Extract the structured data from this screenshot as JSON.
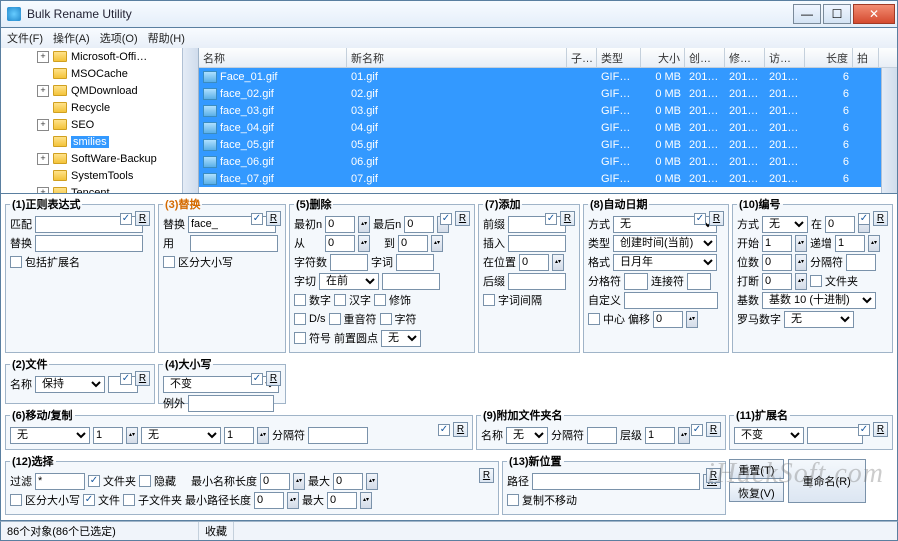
{
  "window": {
    "title": "Bulk Rename Utility"
  },
  "menu": {
    "file": "文件(F)",
    "action": "操作(A)",
    "options": "选项(O)",
    "help": "帮助(H)"
  },
  "tree": [
    {
      "expand": "+",
      "name": "Microsoft-Offi…"
    },
    {
      "expand": "",
      "name": "MSOCache"
    },
    {
      "expand": "+",
      "name": "QMDownload"
    },
    {
      "expand": "",
      "name": "Recycle"
    },
    {
      "expand": "+",
      "name": "SEO"
    },
    {
      "expand": "",
      "name": "smilies",
      "selected": true
    },
    {
      "expand": "+",
      "name": "SoftWare-Backup"
    },
    {
      "expand": "",
      "name": "SystemTools"
    },
    {
      "expand": "+",
      "name": "Tencent"
    }
  ],
  "columns": {
    "name": "名称",
    "newname": "新名称",
    "sub": "子…",
    "type": "类型",
    "size": "大小",
    "created": "创…",
    "modified": "修…",
    "accessed": "访…",
    "length": "长度",
    "taken": "拍"
  },
  "col_w": {
    "name": 148,
    "newname": 220,
    "sub": 30,
    "type": 44,
    "size": 44,
    "created": 40,
    "modified": 40,
    "accessed": 40,
    "length": 48,
    "taken": 26
  },
  "files": [
    {
      "name": "Face_01.gif",
      "new": "01.gif",
      "type": "GIF…",
      "size": "0 MB",
      "c": "201…",
      "m": "201…",
      "a": "201…",
      "len": "6"
    },
    {
      "name": "face_02.gif",
      "new": "02.gif",
      "type": "GIF…",
      "size": "0 MB",
      "c": "201…",
      "m": "201…",
      "a": "201…",
      "len": "6"
    },
    {
      "name": "face_03.gif",
      "new": "03.gif",
      "type": "GIF…",
      "size": "0 MB",
      "c": "201…",
      "m": "201…",
      "a": "201…",
      "len": "6"
    },
    {
      "name": "face_04.gif",
      "new": "04.gif",
      "type": "GIF…",
      "size": "0 MB",
      "c": "201…",
      "m": "201…",
      "a": "201…",
      "len": "6"
    },
    {
      "name": "face_05.gif",
      "new": "05.gif",
      "type": "GIF…",
      "size": "0 MB",
      "c": "201…",
      "m": "201…",
      "a": "201…",
      "len": "6"
    },
    {
      "name": "face_06.gif",
      "new": "06.gif",
      "type": "GIF…",
      "size": "0 MB",
      "c": "201…",
      "m": "201…",
      "a": "201…",
      "len": "6"
    },
    {
      "name": "face_07.gif",
      "new": "07.gif",
      "type": "GIF…",
      "size": "0 MB",
      "c": "201…",
      "m": "201…",
      "a": "201…",
      "len": "6"
    }
  ],
  "p1": {
    "title": "(1)正则表达式",
    "match": "匹配",
    "replace": "替换",
    "incext": "包括扩展名"
  },
  "p3": {
    "title": "(3)替换",
    "replace": "替换",
    "replace_val": "face_",
    "with": "用",
    "case": "区分大小写"
  },
  "p5": {
    "title": "(5)删除",
    "firstn": "最初n",
    "lastn": "最后n",
    "from": "从",
    "to": "到",
    "chars": "字符数",
    "words": "字词",
    "crop": "字切",
    "crop_val": "在前",
    "numbers": "数字",
    "chinese": "汉字",
    "trim": "修饰",
    "ds": "D/s",
    "accent": "重音符",
    "sym": "字符",
    "symbol": "符号",
    "leading": "前置圆点",
    "none": "无"
  },
  "p7": {
    "title": "(7)添加",
    "prefix": "前缀",
    "insert": "插入",
    "atpos": "在位置",
    "suffix": "后缀",
    "wordspace": "字词间隔"
  },
  "p8": {
    "title": "(8)自动日期",
    "mode": "方式",
    "mode_val": "无",
    "type": "类型",
    "type_val": "创建时间(当前)",
    "fmt": "格式",
    "fmt_val": "日月年",
    "sep": "分格符",
    "seg": "连接符",
    "custom": "自定义",
    "center": "中心",
    "offset": "偏移"
  },
  "p10": {
    "title": "(10)编号",
    "mode": "方式",
    "mode_val": "无",
    "at": "在",
    "start": "开始",
    "start_val": "1",
    "incr": "递增",
    "incr_val": "1",
    "pad": "位数",
    "pad_val": "0",
    "sep": "分隔符",
    "break": "打断",
    "break_val": "0",
    "folder": "文件夹",
    "base": "基数",
    "base_val": "基数 10 (十进制)",
    "roman": "罗马数字",
    "roman_val": "无"
  },
  "p2": {
    "title": "(2)文件",
    "name": "名称",
    "name_val": "保持"
  },
  "p4": {
    "title": "(4)大小写",
    "unchanged": "不变",
    "except": "例外"
  },
  "p6": {
    "title": "(6)移动/复制",
    "none": "无",
    "sep": "分隔符",
    "one": "1"
  },
  "p9": {
    "title": "(9)附加文件夹名",
    "name": "名称",
    "name_val": "无",
    "sep": "分隔符",
    "levels": "层级",
    "levels_val": "1"
  },
  "p11": {
    "title": "(11)扩展名",
    "unchanged": "不变"
  },
  "p12": {
    "title": "(12)选择",
    "filter": "过滤",
    "filter_val": "*",
    "folders": "文件夹",
    "hidden": "隐藏",
    "minlen": "最小名称长度",
    "max": "最大",
    "case": "区分大小写",
    "files": "文件",
    "subfolders": "子文件夹",
    "minpath": "最小路径长度"
  },
  "p13": {
    "title": "(13)新位置",
    "path": "路径",
    "copy": "复制不移动"
  },
  "buttons": {
    "reset": "重置(T)",
    "undo": "恢复(V)",
    "rename": "重命名(R)"
  },
  "status": {
    "count": "86个对象(86个已选定)",
    "fav": "收藏"
  },
  "watermark": "iHackSoft.com",
  "r": "R"
}
